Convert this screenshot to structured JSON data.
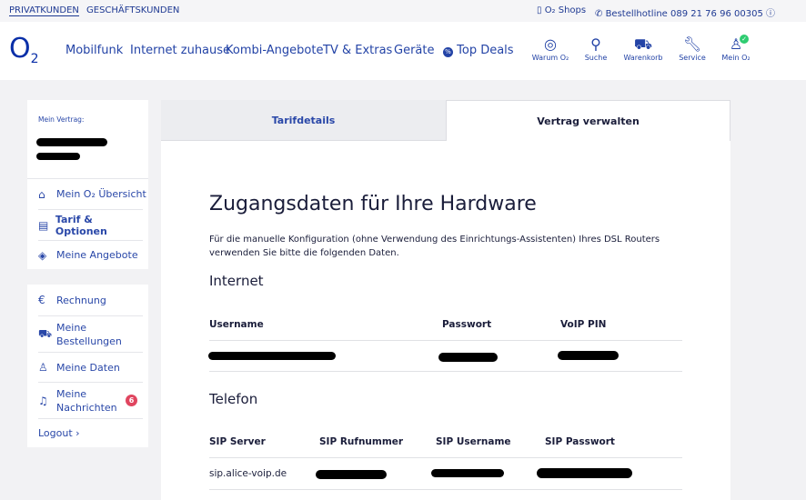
{
  "topbar": {
    "privat": "PRIVATKUNDEN",
    "geschaeft": "GESCHÄFTSKUNDEN",
    "shops": "O₂ Shops",
    "hotline": "Bestellhotline 089 21 76 96 00305"
  },
  "header": {
    "logo": "O",
    "logo_sub": "2",
    "nav": [
      "Mobilfunk",
      "Internet zuhause",
      "Kombi-Angebote",
      "TV & Extras",
      "Geräte",
      "Top Deals"
    ],
    "icons": [
      {
        "label": "Warum O₂",
        "icon": "check-circle-icon"
      },
      {
        "label": "Suche",
        "icon": "search-icon"
      },
      {
        "label": "Warenkorb",
        "icon": "cart-icon"
      },
      {
        "label": "Service",
        "icon": "wrench-icon"
      },
      {
        "label": "Mein O₂",
        "icon": "user-icon"
      }
    ]
  },
  "sidebar": {
    "contract_label": "Mein Vertrag:",
    "items1": [
      "Mein O₂ Übersicht",
      "Tarif & Optionen",
      "Meine Angebote"
    ],
    "items2": [
      "Rechnung",
      "Meine Bestellungen",
      "Meine Daten",
      "Meine Nachrichten"
    ],
    "badge": "6",
    "logout": "Logout"
  },
  "main": {
    "tabs": [
      "Tarifdetails",
      "Vertrag verwalten"
    ],
    "title": "Zugangsdaten für Ihre Hardware",
    "intro": "Für die manuelle Konfiguration (ohne Verwendung des Einrichtungs-Assistenten) Ihres DSL Routers verwenden Sie bitte die folgenden Daten.",
    "internet": {
      "heading": "Internet",
      "cols": [
        "Username",
        "Passwort",
        "VoIP PIN"
      ]
    },
    "telefon": {
      "heading": "Telefon",
      "cols": [
        "SIP Server",
        "SIP Rufnummer",
        "SIP Username",
        "SIP Passwort"
      ],
      "server": "sip.alice-voip.de"
    }
  },
  "colors": {
    "brand": "#0a2fa8",
    "badge": "#e0455f"
  }
}
